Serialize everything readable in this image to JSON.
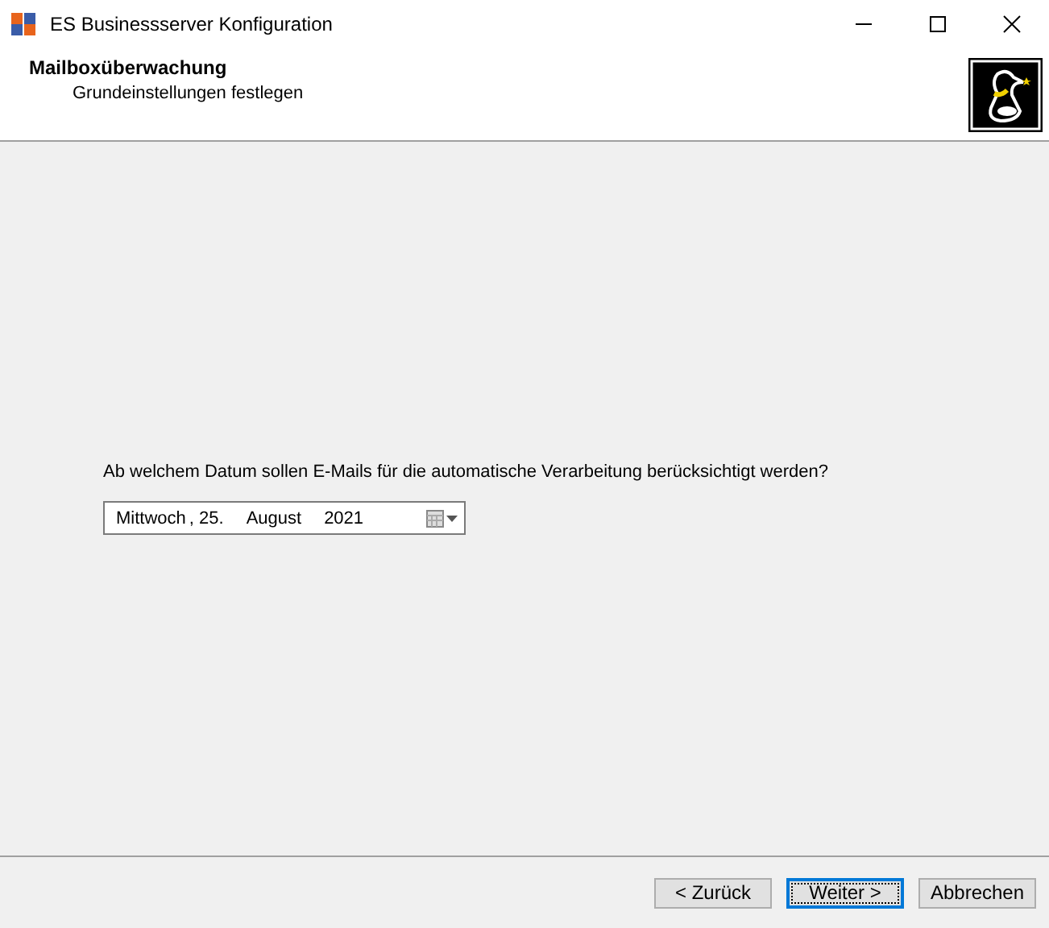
{
  "window": {
    "title": "ES Businessserver Konfiguration"
  },
  "header": {
    "title": "Mailboxüberwachung",
    "subtitle": "Grundeinstellungen festlegen"
  },
  "question": "Ab welchem Datum sollen E-Mails für die automatische Verarbeitung berücksichtigt werden?",
  "date_picker": {
    "parts": [
      "Mittwoch",
      ", 25.",
      "August",
      "2021"
    ]
  },
  "buttons": [
    {
      "label": "< Zurück",
      "focused": false
    },
    {
      "label": "Weiter >",
      "focused": true
    },
    {
      "label": "Abbrechen",
      "focused": false
    }
  ]
}
